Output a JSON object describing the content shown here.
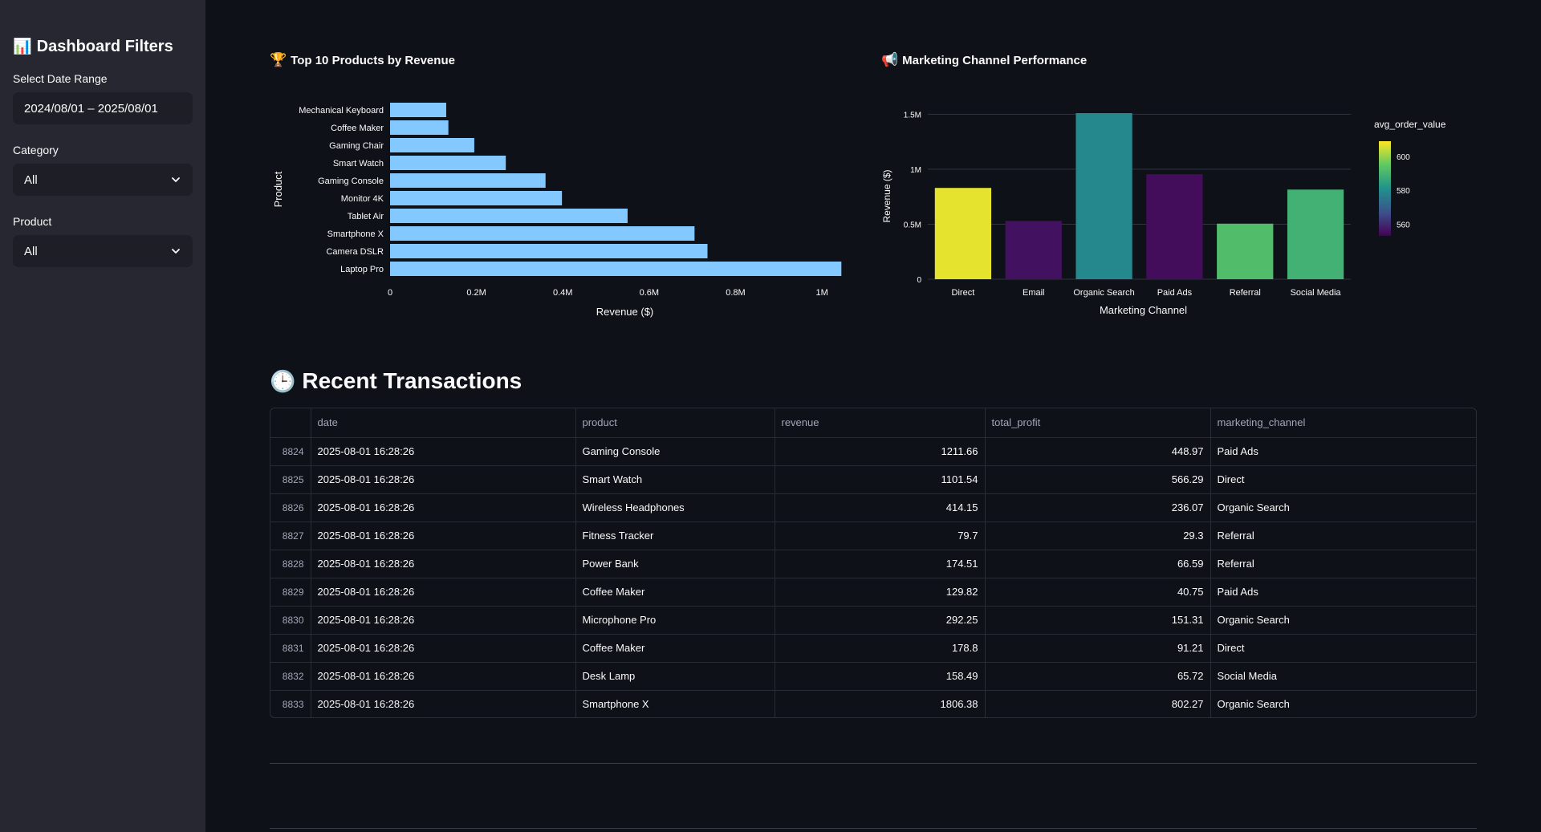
{
  "sidebar": {
    "title": "Dashboard Filters",
    "title_icon": "bar-chart-emoji",
    "date_range": {
      "label": "Select Date Range",
      "value": "2024/08/01 – 2025/08/01"
    },
    "category": {
      "label": "Category",
      "value": "All"
    },
    "product": {
      "label": "Product",
      "value": "All"
    }
  },
  "charts": {
    "top_products": {
      "title": "Top 10 Products by Revenue",
      "icon": "trophy-emoji"
    },
    "marketing": {
      "title": "Marketing Channel Performance",
      "icon": "megaphone-emoji"
    }
  },
  "chart_data": [
    {
      "type": "bar",
      "orientation": "horizontal",
      "title": "Top 10 Products by Revenue",
      "xlabel": "Revenue ($)",
      "ylabel": "Product",
      "categories": [
        "Laptop Pro",
        "Camera DSLR",
        "Smartphone X",
        "Tablet Air",
        "Monitor 4K",
        "Gaming Console",
        "Smart Watch",
        "Gaming Chair",
        "Coffee Maker",
        "Mechanical Keyboard"
      ],
      "values": [
        1045000,
        735000,
        705000,
        550000,
        398000,
        360000,
        268000,
        195000,
        135000,
        130000
      ],
      "xlim": [
        0,
        1050000
      ],
      "xticks": [
        {
          "v": 0,
          "label": "0"
        },
        {
          "v": 200000,
          "label": "0.2M"
        },
        {
          "v": 400000,
          "label": "0.4M"
        },
        {
          "v": 600000,
          "label": "0.6M"
        },
        {
          "v": 800000,
          "label": "0.8M"
        },
        {
          "v": 1000000,
          "label": "1M"
        }
      ],
      "bar_color": "#83c9ff"
    },
    {
      "type": "bar",
      "title": "Marketing Channel Performance",
      "xlabel": "Marketing Channel",
      "ylabel": "Revenue ($)",
      "categories": [
        "Direct",
        "Email",
        "Organic Search",
        "Paid Ads",
        "Referral",
        "Social Media"
      ],
      "values": [
        830000,
        530000,
        1510000,
        955000,
        505000,
        815000
      ],
      "color_values": [
        607,
        556,
        579,
        555,
        592,
        589
      ],
      "colorbar_title": "avg_order_value",
      "colorbar_ticks": [
        {
          "v": 600,
          "label": "600"
        },
        {
          "v": 580,
          "label": "580"
        },
        {
          "v": 560,
          "label": "560"
        }
      ],
      "colorbar_range": [
        553,
        609
      ],
      "ylim": [
        0,
        1510000
      ],
      "yticks": [
        {
          "v": 0,
          "label": "0"
        },
        {
          "v": 500000,
          "label": "0.5M"
        },
        {
          "v": 1000000,
          "label": "1M"
        },
        {
          "v": 1500000,
          "label": "1.5M"
        }
      ],
      "grid": true
    }
  ],
  "transactions": {
    "title": "Recent Transactions",
    "icon": "clock-emoji",
    "columns": [
      "",
      "date",
      "product",
      "revenue",
      "total_profit",
      "marketing_channel"
    ],
    "rows": [
      [
        "8824",
        "2025-08-01 16:28:26",
        "Gaming Console",
        "1211.66",
        "448.97",
        "Paid Ads"
      ],
      [
        "8825",
        "2025-08-01 16:28:26",
        "Smart Watch",
        "1101.54",
        "566.29",
        "Direct"
      ],
      [
        "8826",
        "2025-08-01 16:28:26",
        "Wireless Headphones",
        "414.15",
        "236.07",
        "Organic Search"
      ],
      [
        "8827",
        "2025-08-01 16:28:26",
        "Fitness Tracker",
        "79.7",
        "29.3",
        "Referral"
      ],
      [
        "8828",
        "2025-08-01 16:28:26",
        "Power Bank",
        "174.51",
        "66.59",
        "Referral"
      ],
      [
        "8829",
        "2025-08-01 16:28:26",
        "Coffee Maker",
        "129.82",
        "40.75",
        "Paid Ads"
      ],
      [
        "8830",
        "2025-08-01 16:28:26",
        "Microphone Pro",
        "292.25",
        "151.31",
        "Organic Search"
      ],
      [
        "8831",
        "2025-08-01 16:28:26",
        "Coffee Maker",
        "178.8",
        "91.21",
        "Direct"
      ],
      [
        "8832",
        "2025-08-01 16:28:26",
        "Desk Lamp",
        "158.49",
        "65.72",
        "Social Media"
      ],
      [
        "8833",
        "2025-08-01 16:28:26",
        "Smartphone X",
        "1806.38",
        "802.27",
        "Organic Search"
      ]
    ]
  }
}
